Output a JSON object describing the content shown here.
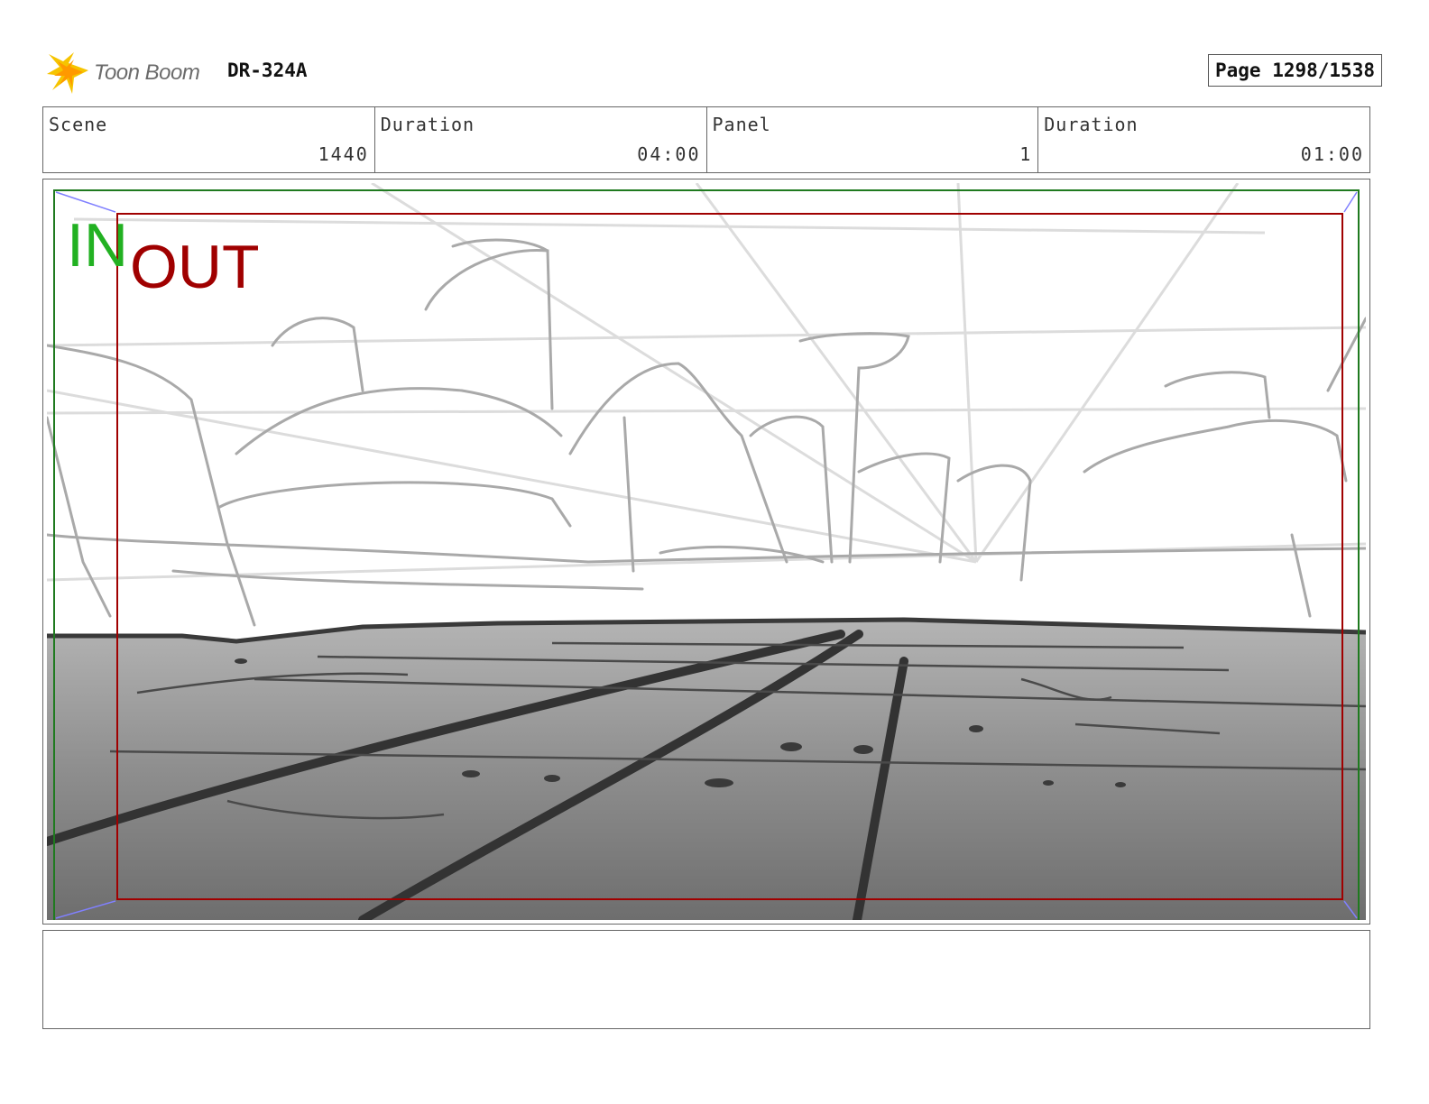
{
  "header": {
    "logo_text": "Toon Boom",
    "project_id": "DR-324A",
    "page_label": "Page 1298/1538"
  },
  "info": {
    "scene_label": "Scene",
    "scene_value": "1440",
    "scene_duration_label": "Duration",
    "scene_duration_value": "04:00",
    "panel_label": "Panel",
    "panel_value": "1",
    "panel_duration_label": "Duration",
    "panel_duration_value": "01:00"
  },
  "panel": {
    "in_label": "IN",
    "out_label": "OUT",
    "in_frame_color": "#1f7a1f",
    "out_frame_color": "#a00000"
  },
  "notes": {
    "text": ""
  }
}
